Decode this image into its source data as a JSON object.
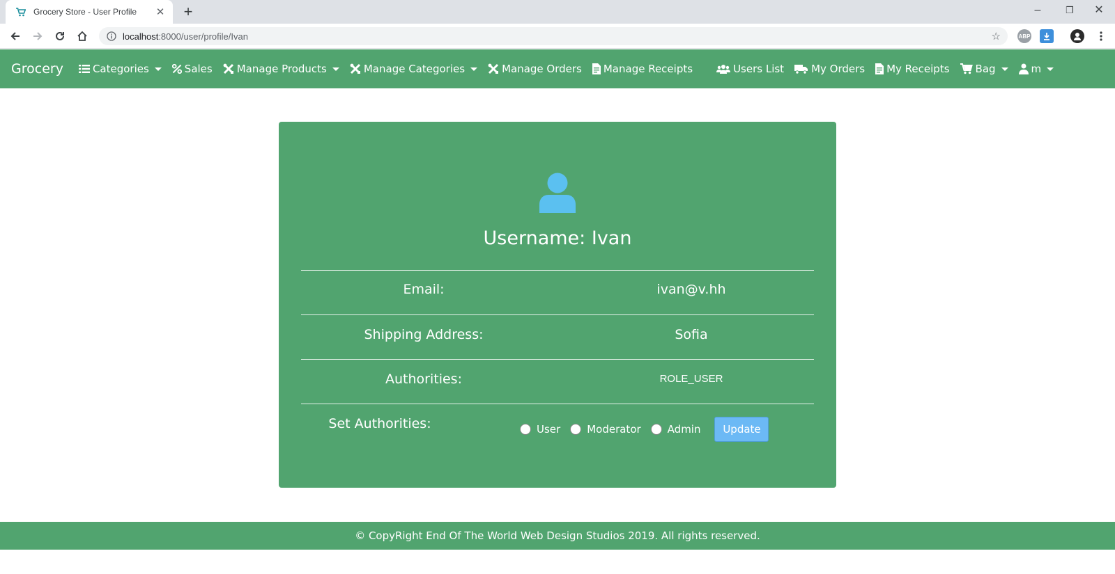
{
  "browser": {
    "tab_title": "Grocery Store - User Profile",
    "url_host": "localhost",
    "url_path": ":8000/user/profile/Ivan",
    "ext_abp_label": "ABP"
  },
  "nav": {
    "brand": "Grocery",
    "items": [
      {
        "label": "Categories",
        "icon": "list-icon",
        "dropdown": true
      },
      {
        "label": "Sales",
        "icon": "percent-icon",
        "dropdown": false
      },
      {
        "label": "Manage Products",
        "icon": "tools-icon",
        "dropdown": true
      },
      {
        "label": "Manage Categories",
        "icon": "tools-icon",
        "dropdown": true
      },
      {
        "label": "Manage Orders",
        "icon": "tools-icon",
        "dropdown": false
      },
      {
        "label": "Manage Receipts",
        "icon": "file-invoice-icon",
        "dropdown": false
      },
      {
        "label": "Users List",
        "icon": "users-icon",
        "dropdown": false
      },
      {
        "label": "My Orders",
        "icon": "truck-icon",
        "dropdown": false
      },
      {
        "label": "My Receipts",
        "icon": "file-invoice-icon",
        "dropdown": false
      },
      {
        "label": "Bag",
        "icon": "cart-icon",
        "dropdown": true
      },
      {
        "label": "m",
        "icon": "user-icon",
        "dropdown": true
      }
    ]
  },
  "profile": {
    "username_label": "Username:",
    "username": "Ivan",
    "email_label": "Email:",
    "email": "ivan@v.hh",
    "address_label": "Shipping Address:",
    "address": "Sofia",
    "authorities_label": "Authorities:",
    "authorities": "ROLE_USER",
    "set_authorities_label": "Set Authorities:",
    "options": [
      "User",
      "Moderator",
      "Admin"
    ],
    "update_label": "Update"
  },
  "footer": {
    "text": "© CopyRight End Of The World Web Design Studios 2019. All rights reserved."
  },
  "colors": {
    "brand_green": "#51a46f",
    "avatar_blue": "#5bc0f0",
    "button_blue": "#6cb9f5"
  }
}
